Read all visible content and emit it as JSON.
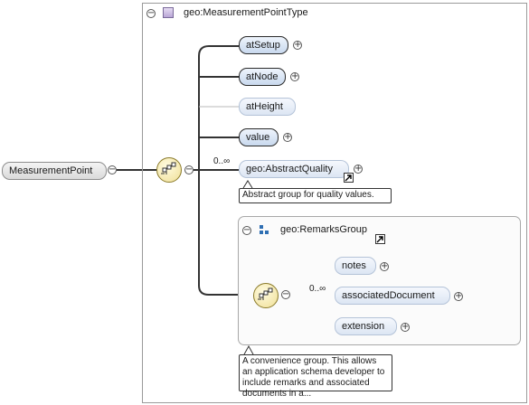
{
  "complex_type": {
    "label": "geo:MeasurementPointType"
  },
  "root_element": {
    "label": "MeasurementPoint"
  },
  "children": {
    "at_setup": "atSetup",
    "at_node": "atNode",
    "at_height": "atHeight",
    "value": "value",
    "abstract_quality": "geo:AbstractQuality",
    "abstract_quality_multiplicity": "0..∞",
    "abstract_quality_note": "Abstract group for quality values."
  },
  "remarks_group": {
    "label": "geo:RemarksGroup",
    "multiplicity": "0..∞",
    "notes": "notes",
    "associated_document": "associatedDocument",
    "extension": "extension",
    "annotation": "A convenience group. This allows an application schema developer to include remarks and associated documents in a..."
  },
  "icons": {
    "collapse": "collapse-icon",
    "expand": "expand-icon",
    "sequence": "sequence-icon",
    "complex_type": "complex-type-icon",
    "group": "group-icon",
    "link": "link-arrow-icon"
  }
}
